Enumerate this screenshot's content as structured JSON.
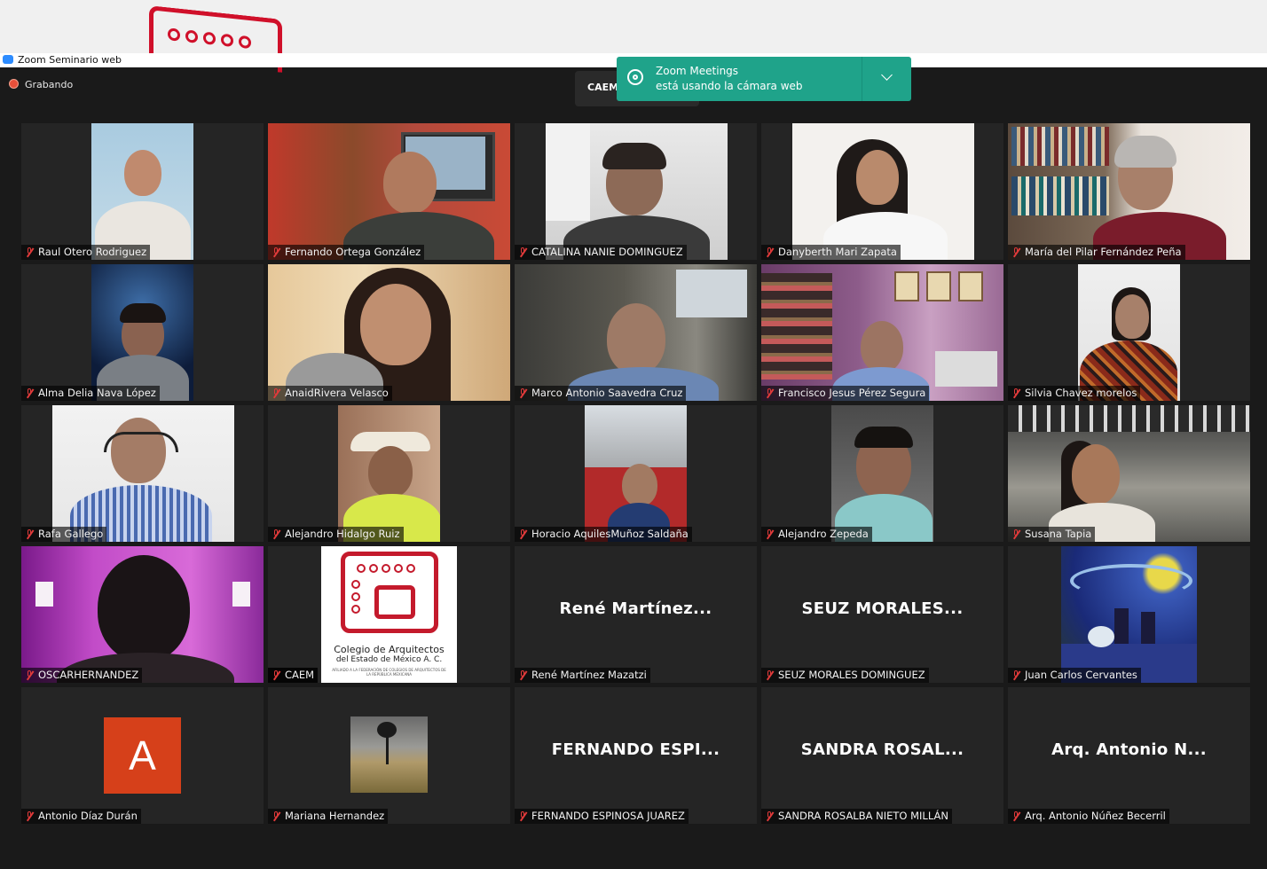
{
  "window": {
    "title": "Zoom Seminario web"
  },
  "recording": {
    "label": "Grabando"
  },
  "meeting_tab": {
    "label": "CAEM"
  },
  "notification": {
    "line1": "Zoom Meetings",
    "line2": "está usando la cámara web"
  },
  "logo": {
    "line1": "Colegio de Arquitectos",
    "line2": "del Estado de México A. C.",
    "line3": "AFILIADO A LA FEDERACIÓN DE COLEGIOS DE ARQUITECTOS DE LA REPÚBLICA MEXICANA"
  },
  "participants": [
    {
      "name": "Raul Otero Rodriguez",
      "muted": true
    },
    {
      "name": "Fernando Ortega González",
      "muted": true
    },
    {
      "name": "CATALINA NANIE DOMINGUEZ",
      "muted": true
    },
    {
      "name": "Danyberth Mari Zapata",
      "muted": true
    },
    {
      "name": "María del Pilar Fernández Peña",
      "muted": true
    },
    {
      "name": "Alma Delia Nava López",
      "muted": true
    },
    {
      "name": "AnaidRivera Velasco",
      "muted": true
    },
    {
      "name": "Marco Antonio Saavedra Cruz",
      "muted": true
    },
    {
      "name": "Francisco Jesus Pérez Segura",
      "muted": true
    },
    {
      "name": "Silvia Chavez morelos",
      "muted": true
    },
    {
      "name": "Rafa Gallego",
      "muted": true
    },
    {
      "name": "Alejandro Hidalgo Ruiz",
      "muted": true
    },
    {
      "name": "Horacio AquilesMuñoz Saldaña",
      "muted": true
    },
    {
      "name": "Alejandro Zepeda",
      "muted": true
    },
    {
      "name": "Susana Tapia",
      "muted": true
    },
    {
      "name": "OSCARHERNANDEZ",
      "muted": true
    },
    {
      "name": "CAEM",
      "muted": true
    },
    {
      "name": "René Martínez Mazatzi",
      "display": "René  Martínez...",
      "muted": true
    },
    {
      "name": "SEUZ MORALES DOMINGUEZ",
      "display": "SEUZ  MORALES...",
      "muted": true
    },
    {
      "name": "Juan Carlos Cervantes",
      "muted": true
    },
    {
      "name": "Antonio Díaz Durán",
      "avatar_letter": "A",
      "muted": true
    },
    {
      "name": "Mariana Hernandez",
      "muted": true
    },
    {
      "name": "FERNANDO ESPINOSA JUAREZ",
      "display": "FERNANDO  ESPI...",
      "muted": true
    },
    {
      "name": "SANDRA ROSALBA NIETO MILLÁN",
      "display": "SANDRA  ROSAL...",
      "muted": true
    },
    {
      "name": "Arq.  Antonio Núñez Becerril",
      "display": "Arq.   Antonio  N...",
      "muted": true
    }
  ],
  "colors": {
    "background": "#1a1a1a",
    "tile": "#252525",
    "notification": "#1fa38a",
    "muted_icon": "#e03a3a",
    "avatar": "#d6401a"
  }
}
